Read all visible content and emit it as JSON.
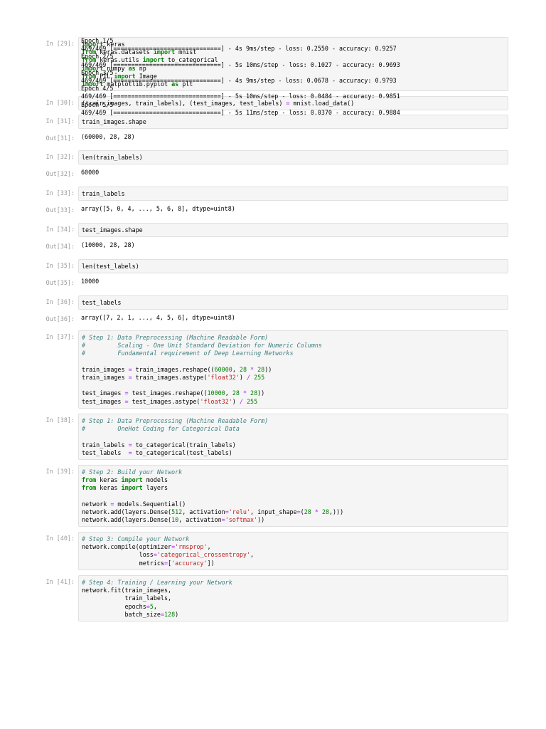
{
  "cells": [
    {
      "in": "In [29]:",
      "code": [
        [
          [
            "kw",
            "import"
          ],
          [
            "t",
            " keras"
          ]
        ],
        [
          [
            "kw",
            "from"
          ],
          [
            "t",
            " keras.datasets "
          ],
          [
            "kw",
            "import"
          ],
          [
            "t",
            " mnist"
          ]
        ],
        [
          [
            "kw",
            "from"
          ],
          [
            "t",
            " keras.utils "
          ],
          [
            "kw",
            "import"
          ],
          [
            "t",
            " to_categorical"
          ]
        ],
        [
          [
            "kw",
            "import"
          ],
          [
            "t",
            " numpy "
          ],
          [
            "kw",
            "as"
          ],
          [
            "t",
            " np"
          ]
        ],
        [
          [
            "kw",
            "from"
          ],
          [
            "t",
            " PIL "
          ],
          [
            "kw",
            "import"
          ],
          [
            "t",
            " Image"
          ]
        ],
        [
          [
            "kw",
            "import"
          ],
          [
            "t",
            " matplotlib.pyplot "
          ],
          [
            "kw",
            "as"
          ],
          [
            "t",
            " plt"
          ]
        ]
      ]
    },
    {
      "in": "In [30]:",
      "code": [
        [
          [
            "t",
            "(train_images, train_labels), (test_images, test_labels) "
          ],
          [
            "op",
            "="
          ],
          [
            "t",
            " mnist.load_data()"
          ]
        ]
      ]
    },
    {
      "in": "In [31]:",
      "code": [
        [
          [
            "t",
            "train_images.shape"
          ]
        ]
      ],
      "out_prompt": "Out[31]:",
      "out": [
        "(60000, 28, 28)"
      ]
    },
    {
      "in": "In [32]:",
      "code": [
        [
          [
            "t",
            "len(train_labels)"
          ]
        ]
      ],
      "out_prompt": "Out[32]:",
      "out": [
        "60000"
      ]
    },
    {
      "in": "In [33]:",
      "code": [
        [
          [
            "t",
            "train_labels"
          ]
        ]
      ],
      "out_prompt": "Out[33]:",
      "out": [
        "array([5, 0, 4, ..., 5, 6, 8], dtype=uint8)"
      ]
    },
    {
      "in": "In [34]:",
      "code": [
        [
          [
            "t",
            "test_images.shape"
          ]
        ]
      ],
      "out_prompt": "Out[34]:",
      "out": [
        "(10000, 28, 28)"
      ]
    },
    {
      "in": "In [35]:",
      "code": [
        [
          [
            "t",
            "len(test_labels)"
          ]
        ]
      ],
      "out_prompt": "Out[35]:",
      "out": [
        "10000"
      ]
    },
    {
      "in": "In [36]:",
      "code": [
        [
          [
            "t",
            "test_labels"
          ]
        ]
      ],
      "out_prompt": "Out[36]:",
      "out": [
        "array([7, 2, 1, ..., 4, 5, 6], dtype=uint8)"
      ]
    },
    {
      "in": "In [37]:",
      "code": [
        [
          [
            "cm",
            "# Step 1: Data Preprocessing (Machine Readable Form)"
          ]
        ],
        [
          [
            "cm",
            "#         Scaling - One Unit Standard Deviation for Numeric Columns"
          ]
        ],
        [
          [
            "cm",
            "#         Fundamental requirement of Deep Learning Networks"
          ]
        ],
        [
          [
            "t",
            ""
          ]
        ],
        [
          [
            "t",
            "train_images "
          ],
          [
            "op",
            "="
          ],
          [
            "t",
            " train_images.reshape(("
          ],
          [
            "nu",
            "60000"
          ],
          [
            "t",
            ", "
          ],
          [
            "nu",
            "28"
          ],
          [
            "t",
            " "
          ],
          [
            "op",
            "*"
          ],
          [
            "t",
            " "
          ],
          [
            "nu",
            "28"
          ],
          [
            "t",
            "))"
          ]
        ],
        [
          [
            "t",
            "train_images "
          ],
          [
            "op",
            "="
          ],
          [
            "t",
            " train_images.astype("
          ],
          [
            "st",
            "'float32'"
          ],
          [
            "t",
            ") "
          ],
          [
            "op",
            "/"
          ],
          [
            "t",
            " "
          ],
          [
            "nu",
            "255"
          ]
        ],
        [
          [
            "t",
            ""
          ]
        ],
        [
          [
            "t",
            "test_images "
          ],
          [
            "op",
            "="
          ],
          [
            "t",
            " test_images.reshape(("
          ],
          [
            "nu",
            "10000"
          ],
          [
            "t",
            ", "
          ],
          [
            "nu",
            "28"
          ],
          [
            "t",
            " "
          ],
          [
            "op",
            "*"
          ],
          [
            "t",
            " "
          ],
          [
            "nu",
            "28"
          ],
          [
            "t",
            "))"
          ]
        ],
        [
          [
            "t",
            "test_images "
          ],
          [
            "op",
            "="
          ],
          [
            "t",
            " test_images.astype("
          ],
          [
            "st",
            "'float32'"
          ],
          [
            "t",
            ") "
          ],
          [
            "op",
            "/"
          ],
          [
            "t",
            " "
          ],
          [
            "nu",
            "255"
          ]
        ]
      ]
    },
    {
      "in": "In [38]:",
      "code": [
        [
          [
            "cm",
            "# Step 1: Data Preprocessing (Machine Readable Form)"
          ]
        ],
        [
          [
            "cm",
            "#         OneHot Coding for Categorical Data"
          ]
        ],
        [
          [
            "t",
            ""
          ]
        ],
        [
          [
            "t",
            "train_labels "
          ],
          [
            "op",
            "="
          ],
          [
            "t",
            " to_categorical(train_labels)"
          ]
        ],
        [
          [
            "t",
            "test_labels  "
          ],
          [
            "op",
            "="
          ],
          [
            "t",
            " to_categorical(test_labels)"
          ]
        ]
      ]
    },
    {
      "in": "In [39]:",
      "code": [
        [
          [
            "cm",
            "# Step 2: Build your Network"
          ]
        ],
        [
          [
            "kw",
            "from"
          ],
          [
            "t",
            " keras "
          ],
          [
            "kw",
            "import"
          ],
          [
            "t",
            " models"
          ]
        ],
        [
          [
            "kw",
            "from"
          ],
          [
            "t",
            " keras "
          ],
          [
            "kw",
            "import"
          ],
          [
            "t",
            " layers"
          ]
        ],
        [
          [
            "t",
            ""
          ]
        ],
        [
          [
            "t",
            "network "
          ],
          [
            "op",
            "="
          ],
          [
            "t",
            " models.Sequential()"
          ]
        ],
        [
          [
            "t",
            "network.add(layers.Dense("
          ],
          [
            "nu",
            "512"
          ],
          [
            "t",
            ", activation"
          ],
          [
            "op",
            "="
          ],
          [
            "st",
            "'relu'"
          ],
          [
            "t",
            ", input_shape"
          ],
          [
            "op",
            "="
          ],
          [
            "t",
            "("
          ],
          [
            "nu",
            "28"
          ],
          [
            "t",
            " "
          ],
          [
            "op",
            "*"
          ],
          [
            "t",
            " "
          ],
          [
            "nu",
            "28"
          ],
          [
            "t",
            ",)))"
          ]
        ],
        [
          [
            "t",
            "network.add(layers.Dense("
          ],
          [
            "nu",
            "10"
          ],
          [
            "t",
            ", activation"
          ],
          [
            "op",
            "="
          ],
          [
            "st",
            "'softmax'"
          ],
          [
            "t",
            "))"
          ]
        ]
      ]
    },
    {
      "in": "In [40]:",
      "code": [
        [
          [
            "cm",
            "# Step 3: Compile your Network"
          ]
        ],
        [
          [
            "t",
            "network.compile(optimizer"
          ],
          [
            "op",
            "="
          ],
          [
            "st",
            "'rmsprop'"
          ],
          [
            "t",
            ","
          ]
        ],
        [
          [
            "t",
            "                loss"
          ],
          [
            "op",
            "="
          ],
          [
            "st",
            "'categorical_crossentropy'"
          ],
          [
            "t",
            ","
          ]
        ],
        [
          [
            "t",
            "                metrics"
          ],
          [
            "op",
            "="
          ],
          [
            "t",
            "["
          ],
          [
            "st",
            "'accuracy'"
          ],
          [
            "t",
            "])"
          ]
        ]
      ]
    },
    {
      "in": "In [41]:",
      "code": [
        [
          [
            "cm",
            "# Step 4: Training / Learning your Network"
          ]
        ],
        [
          [
            "t",
            "network.fit(train_images,"
          ]
        ],
        [
          [
            "t",
            "            train_labels,"
          ]
        ],
        [
          [
            "t",
            "            epochs"
          ],
          [
            "op",
            "="
          ],
          [
            "nu",
            "5"
          ],
          [
            "t",
            ","
          ]
        ],
        [
          [
            "t",
            "            batch_size"
          ],
          [
            "op",
            "="
          ],
          [
            "nu",
            "128"
          ],
          [
            "t",
            ")"
          ]
        ]
      ],
      "out_prompt": "",
      "out": [
        "Epoch 1/5",
        "469/469 [==============================] - 4s 9ms/step - loss: 0.2550 - accuracy: 0.9257",
        "Epoch 2/5",
        "469/469 [==============================] - 5s 10ms/step - loss: 0.1027 - accuracy: 0.9693",
        "Epoch 3/5",
        "469/469 [==============================] - 4s 9ms/step - loss: 0.0678 - accuracy: 0.9793",
        "Epoch 4/5",
        "469/469 [==============================] - 5s 10ms/step - loss: 0.0484 - accuracy: 0.9851",
        "Epoch 5/5",
        "469/469 [==============================] - 5s 11ms/step - loss: 0.0370 - accuracy: 0.9884"
      ]
    }
  ]
}
